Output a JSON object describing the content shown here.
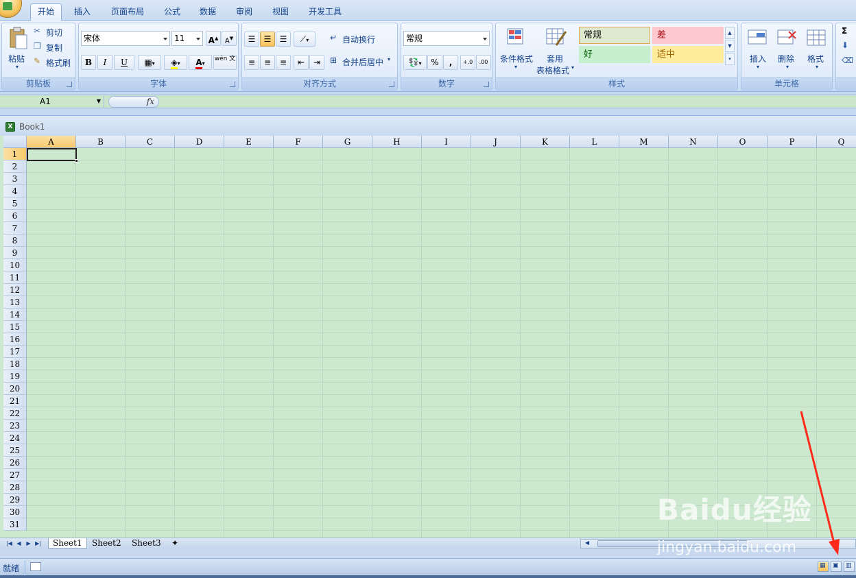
{
  "tabs": [
    "开始",
    "插入",
    "页面布局",
    "公式",
    "数据",
    "审阅",
    "视图",
    "开发工具"
  ],
  "clipboard": {
    "paste": "粘贴",
    "cut": "剪切",
    "copy": "复制",
    "format_painter": "格式刷",
    "label": "剪贴板"
  },
  "font": {
    "name": "宋体",
    "size": "11",
    "label": "字体",
    "bold": "B",
    "italic": "I",
    "underline": "U",
    "grow": "A",
    "shrink": "A",
    "phonetic": "wén 文"
  },
  "alignment": {
    "wrap": "自动换行",
    "merge": "合并后居中",
    "label": "对齐方式"
  },
  "number": {
    "format": "常规",
    "percent": "%",
    "comma": ",",
    "label": "数字"
  },
  "styles": {
    "conditional": "条件格式",
    "table_line1": "套用",
    "table_line2": "表格格式",
    "normal": "常规",
    "bad": "差",
    "good": "好",
    "neutral": "适中",
    "label": "样式"
  },
  "cells_group": {
    "insert": "插入",
    "delete": "删除",
    "format": "格式",
    "label": "单元格"
  },
  "editing": {
    "sigma": "Σ"
  },
  "formula_bar": {
    "name_box": "A1",
    "fx": "fx"
  },
  "workbook": {
    "title": "Book1"
  },
  "columns": [
    "A",
    "B",
    "C",
    "D",
    "E",
    "F",
    "G",
    "H",
    "I",
    "J",
    "K",
    "L",
    "M",
    "N",
    "O",
    "P",
    "Q"
  ],
  "rows": [
    "1",
    "2",
    "3",
    "4",
    "5",
    "6",
    "7",
    "8",
    "9",
    "10",
    "11",
    "12",
    "13",
    "14",
    "15",
    "16",
    "17",
    "18",
    "19",
    "20",
    "21",
    "22",
    "23",
    "24",
    "25",
    "26",
    "27",
    "28",
    "29",
    "30",
    "31"
  ],
  "sheets": [
    "Sheet1",
    "Sheet2",
    "Sheet3"
  ],
  "status": {
    "ready": "就绪"
  },
  "watermark": {
    "brand": "Baidu经验",
    "url": "jingyan.baidu.com"
  },
  "colors": {
    "grid_bg": "#cce8cf",
    "bad_bg": "#ffc7ce",
    "bad_fg": "#9c0006",
    "good_bg": "#c6efce",
    "neutral_bg": "#ffeb9c",
    "annotation": "#ff2a1a"
  }
}
